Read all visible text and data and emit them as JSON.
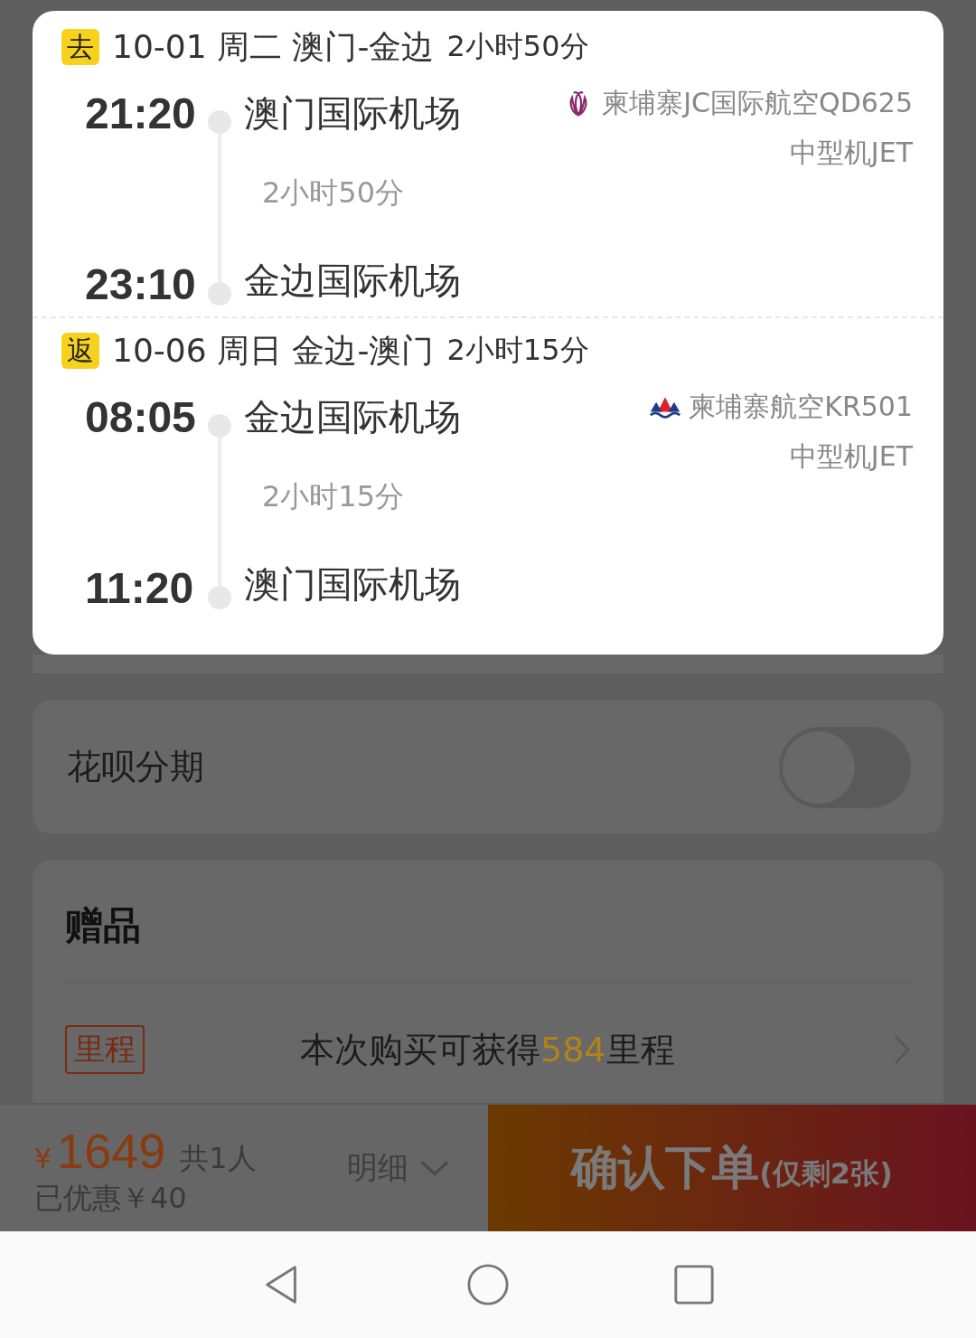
{
  "legs": [
    {
      "tag": "去",
      "title": "10-01 周二 澳门-金边",
      "duration": "2小时50分",
      "departure": {
        "time": "21:20",
        "airport": "澳门国际机场"
      },
      "arrival": {
        "time": "23:10",
        "airport": "金边国际机场"
      },
      "flight_time": "2小时50分",
      "airline": "柬埔寨JC国际航空QD625",
      "aircraft": "中型机JET",
      "kind": "lotus"
    },
    {
      "tag": "返",
      "title": "10-06 周日 金边-澳门",
      "duration": "2小时15分",
      "departure": {
        "time": "08:05",
        "airport": "金边国际机场"
      },
      "arrival": {
        "time": "11:20",
        "airport": "澳门国际机场"
      },
      "flight_time": "2小时15分",
      "airline": "柬埔寨航空KR501",
      "aircraft": "中型机JET",
      "kind": "mountains"
    }
  ],
  "installment": {
    "label": "花呗分期",
    "on": false
  },
  "gift": {
    "title": "赠品",
    "tag": "里程",
    "text_before": "本次购买可获得",
    "highlight": "584",
    "text_after": "里程"
  },
  "bottom_bar": {
    "currency": "¥",
    "price": "1649",
    "people": "共1人",
    "discount": "已优惠￥40",
    "details": "明细",
    "confirm": "确认下单",
    "confirm_note": "(仅剩2张)"
  }
}
